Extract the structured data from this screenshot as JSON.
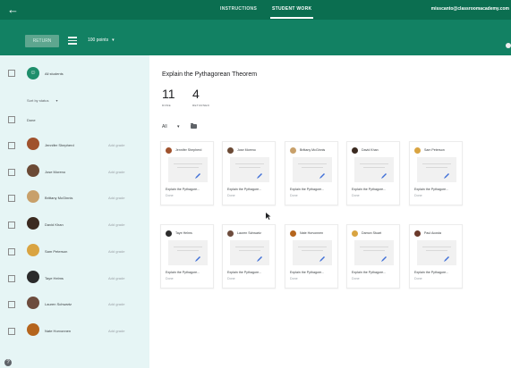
{
  "topbar": {
    "back_glyph": "←",
    "tabs": [
      {
        "label": "INSTRUCTIONS",
        "active": false
      },
      {
        "label": "STUDENT WORK",
        "active": true
      }
    ],
    "account_email": "misscanto@classroomacademy.com"
  },
  "toolbar": {
    "return_label": "RETURN",
    "points_label": "100 points",
    "points_caret": "▾"
  },
  "sidebar": {
    "all_students_label": "All students",
    "sort_label": "Sort by status",
    "sort_caret": "▾",
    "section_label": "Done",
    "add_grade_label": "Add grade",
    "students": [
      {
        "name": "Jennifer Shepherd",
        "avatar_color": "#a0522d"
      },
      {
        "name": "Jose Moreno",
        "avatar_color": "#6b4a35"
      },
      {
        "name": "Brittany McGinnis",
        "avatar_color": "#c8a06a"
      },
      {
        "name": "David Khan",
        "avatar_color": "#3b2a20"
      },
      {
        "name": "Sam Peterson",
        "avatar_color": "#d9a441"
      },
      {
        "name": "Taye Helms",
        "avatar_color": "#2b2b2b"
      },
      {
        "name": "Lauren Schwartz",
        "avatar_color": "#6d4c3d"
      },
      {
        "name": "Nate Horvonnen",
        "avatar_color": "#b5651d"
      }
    ]
  },
  "main": {
    "assignment_title": "Explain the Pythagorean Theorem",
    "done_count": "11",
    "done_label": "DONE",
    "returned_count": "4",
    "returned_label": "RETURNED",
    "filter_label": "All",
    "filter_caret": "▾"
  },
  "cards": [
    {
      "name": "Jennifer Shepherd",
      "file": "Explain the Pythagore...",
      "status": "Done",
      "avatar_color": "#a0522d"
    },
    {
      "name": "Jose Moreno",
      "file": "Explain the Pythagore...",
      "status": "Done",
      "avatar_color": "#6b4a35"
    },
    {
      "name": "Brittany McGinnis",
      "file": "Explain the Pythagore...",
      "status": "Done",
      "avatar_color": "#c8a06a"
    },
    {
      "name": "David Khan",
      "file": "Explain the Pythagore...",
      "status": "Done",
      "avatar_color": "#3b2a20"
    },
    {
      "name": "Sam Peterson",
      "file": "Explain the Pythagore...",
      "status": "Done",
      "avatar_color": "#d9a441"
    },
    {
      "name": "Taye Helms",
      "file": "Explain the Pythagore...",
      "status": "Done",
      "avatar_color": "#2b2b2b"
    },
    {
      "name": "Lauren Schwartz",
      "file": "Explain the Pythagore...",
      "status": "Done",
      "avatar_color": "#6d4c3d"
    },
    {
      "name": "Nate Horvonnen",
      "file": "Explain the Pythagore...",
      "status": "Done",
      "avatar_color": "#b5651d"
    },
    {
      "name": "Damon Stuart",
      "file": "Explain the Pythagore...",
      "status": "Done",
      "avatar_color": "#d9a441"
    },
    {
      "name": "Paul Acosta",
      "file": "Explain the Pythagore...",
      "status": "Done",
      "avatar_color": "#6b3a2a"
    }
  ],
  "icons": {
    "help": "?",
    "all_students": "☺"
  },
  "colors": {
    "topbar": "#0b6e50",
    "toolbar": "#128163",
    "sidebar": "#e6f5f5",
    "accent_pen": "#3f6fd8"
  }
}
